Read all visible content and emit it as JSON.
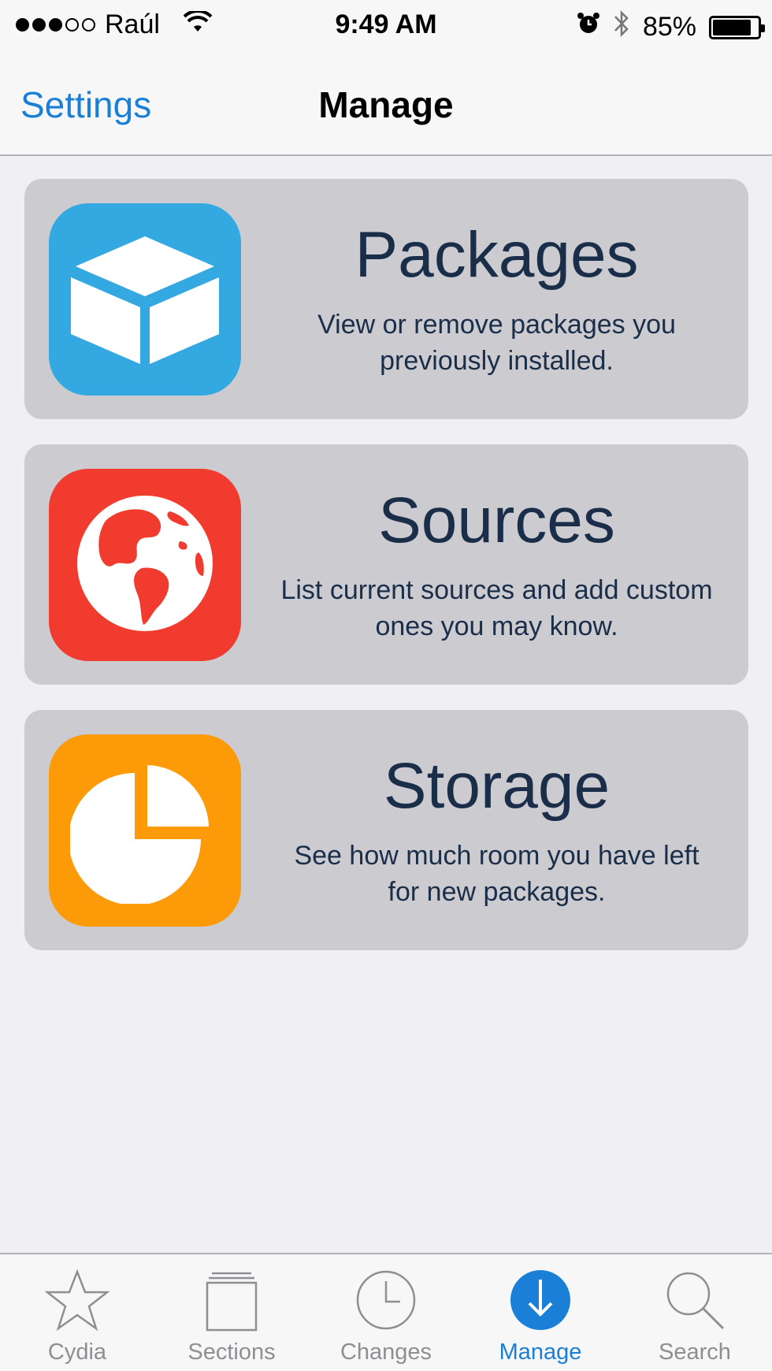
{
  "status_bar": {
    "carrier": "Raúl",
    "time": "9:49 AM",
    "battery": "85%",
    "battery_level": 0.85,
    "signal_bars_filled": 3,
    "signal_bars_total": 5
  },
  "nav": {
    "back_label": "Settings",
    "title": "Manage"
  },
  "cards": [
    {
      "title": "Packages",
      "description": "View or remove packages you previously installed.",
      "icon": "package-box-icon",
      "color": "#34a8e0"
    },
    {
      "title": "Sources",
      "description": "List current sources and add custom ones you may know.",
      "icon": "globe-icon",
      "color": "#f23b2f"
    },
    {
      "title": "Storage",
      "description": "See how much room you have left for new packages.",
      "icon": "pie-chart-icon",
      "color": "#fc9a08"
    }
  ],
  "tabs": [
    {
      "label": "Cydia",
      "icon": "star-icon",
      "active": false
    },
    {
      "label": "Sections",
      "icon": "sections-icon",
      "active": false
    },
    {
      "label": "Changes",
      "icon": "clock-icon",
      "active": false
    },
    {
      "label": "Manage",
      "icon": "download-icon",
      "active": true
    },
    {
      "label": "Search",
      "icon": "search-icon",
      "active": false
    }
  ],
  "colors": {
    "accent": "#1a7fd6",
    "card_background": "#cbcbd0",
    "card_text": "#1a2e4a",
    "page_background": "#efeff4"
  }
}
